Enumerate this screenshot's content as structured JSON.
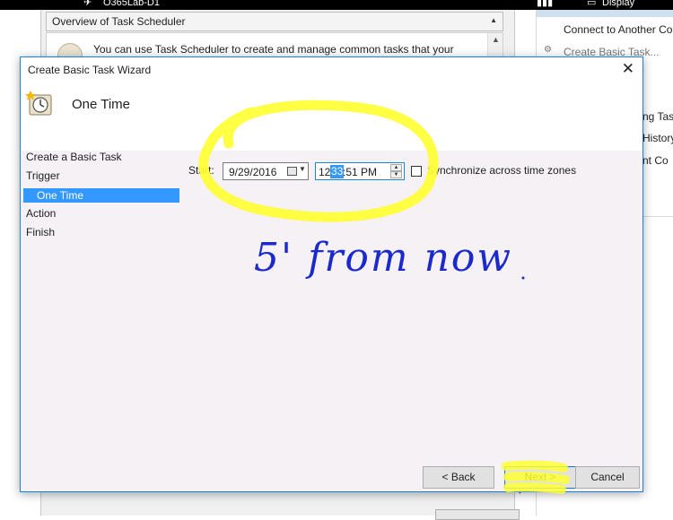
{
  "taskbar": {
    "vm_name": "O365Lab-D1",
    "display_label": "Display"
  },
  "background_window": {
    "section_title": "Overview of Task Scheduler",
    "body_text": "You can use Task Scheduler to create and manage common tasks that your"
  },
  "actions_pane": {
    "items": [
      "Connect to Another Co",
      "Create Basic Task...",
      "ng Tas",
      "History",
      "nt Co"
    ]
  },
  "dialog": {
    "title": "Create Basic Task Wizard",
    "heading": "One Time",
    "nav": {
      "items": [
        "Create a Basic Task",
        "Trigger",
        "One Time",
        "Action",
        "Finish"
      ]
    },
    "start": {
      "label": "Start:",
      "date": "9/29/2016",
      "time_pre": "12:",
      "time_selected": "33",
      "time_post": ":51 PM"
    },
    "sync_label": "Synchronize across time zones",
    "buttons": {
      "back": "< Back",
      "next": "Next >",
      "cancel": "Cancel"
    }
  },
  "annotation": {
    "text": "5' from now",
    "color": "#1a2acc",
    "highlight_color": "#ffff33"
  },
  "colors": {
    "accent": "#1883d7",
    "selection": "#3399ff",
    "content_bg": "#f5f1f4"
  }
}
